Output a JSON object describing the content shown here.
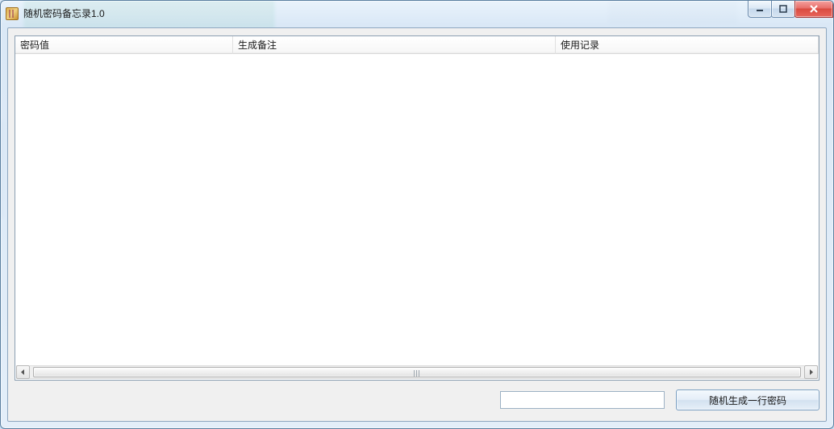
{
  "window": {
    "title": "随机密码备忘录1.0"
  },
  "columns": {
    "c1": "密码值",
    "c2": "生成备注",
    "c3": "使用记录"
  },
  "rows": [],
  "input": {
    "value": ""
  },
  "buttons": {
    "generate": "随机生成一行密码"
  }
}
